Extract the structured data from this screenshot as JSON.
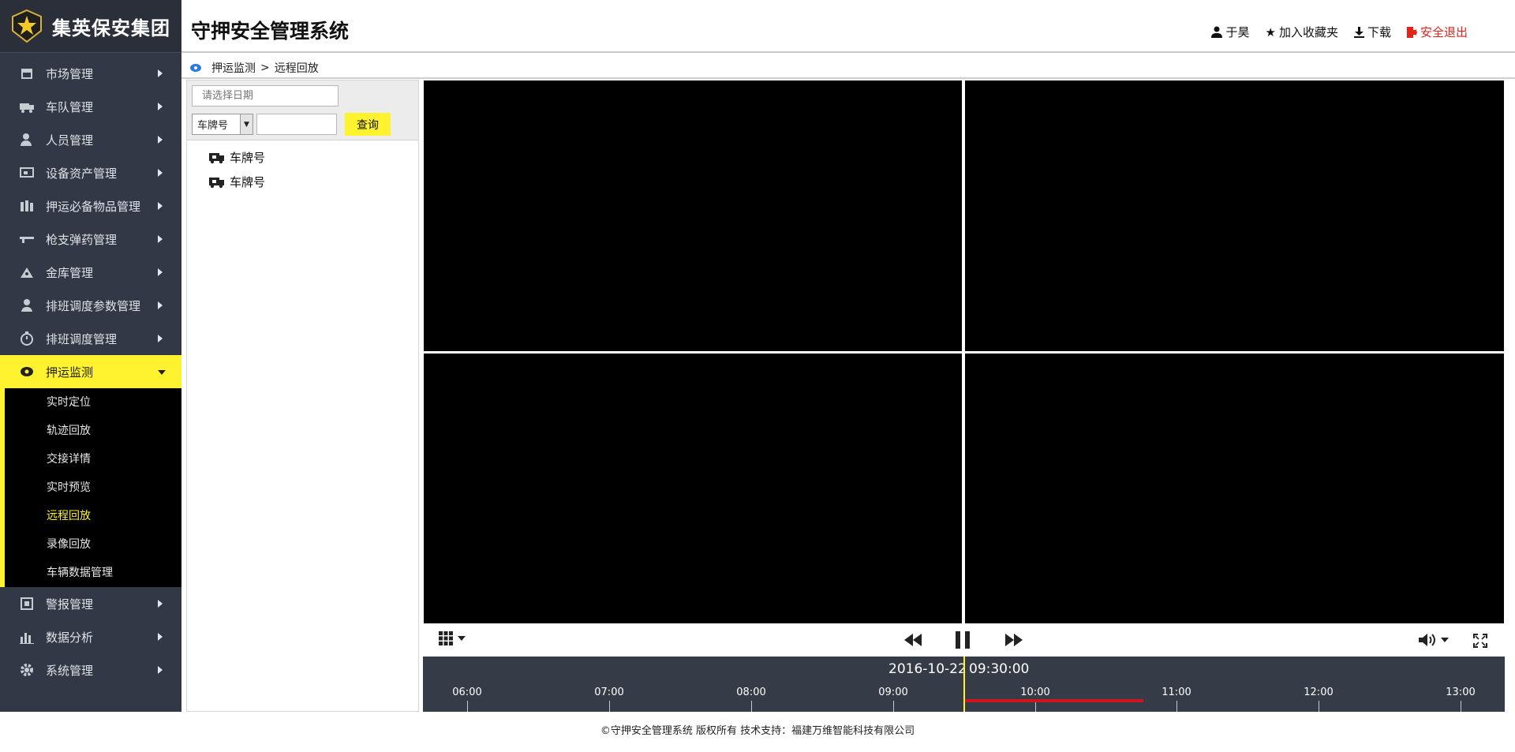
{
  "company_name": "集英保安集团",
  "system_title": "守押安全管理系统",
  "user": {
    "name": "于昊"
  },
  "header_links": {
    "favorite": "加入收藏夹",
    "download": "下载",
    "logout": "安全退出"
  },
  "breadcrumb": {
    "parent": "押运监测",
    "separator": ">",
    "current": "远程回放"
  },
  "menu": {
    "items": [
      {
        "label": "市场管理",
        "icon": "store-icon"
      },
      {
        "label": "车队管理",
        "icon": "truck-icon"
      },
      {
        "label": "人员管理",
        "icon": "person-icon"
      },
      {
        "label": "设备资产管理",
        "icon": "device-icon"
      },
      {
        "label": "押运必备物品管理",
        "icon": "supplies-icon"
      },
      {
        "label": "枪支弹药管理",
        "icon": "gun-icon"
      },
      {
        "label": "金库管理",
        "icon": "vault-icon"
      },
      {
        "label": "排班调度参数管理",
        "icon": "settings-person-icon"
      },
      {
        "label": "排班调度管理",
        "icon": "stopwatch-icon"
      },
      {
        "label": "押运监测",
        "icon": "monitor-icon",
        "active": true
      }
    ],
    "submenu": [
      "实时定位",
      "轨迹回放",
      "交接详情",
      "实时预览",
      "远程回放",
      "录像回放",
      "车辆数据管理"
    ],
    "submenu_current": "远程回放",
    "bottom_items": [
      {
        "label": "警报管理",
        "icon": "alarm-icon"
      },
      {
        "label": "数据分析",
        "icon": "bar-chart-icon"
      },
      {
        "label": "系统管理",
        "icon": "gear-icon"
      }
    ]
  },
  "search": {
    "date_placeholder": "请选择日期",
    "select_value": "车牌号",
    "query_button": "查询"
  },
  "tree": [
    "车牌号",
    "车牌号"
  ],
  "timeline": {
    "date": "2016-10-22",
    "time": "09:30:00",
    "ticks": [
      "06:00",
      "07:00",
      "08:00",
      "09:00",
      "10:00",
      "11:00",
      "12:00",
      "13:00"
    ]
  },
  "footer": "©守押安全管理系统  版权所有   技术支持：福建万维智能科技有限公司",
  "colors": {
    "accent": "#fff22e",
    "sidebar": "#323845",
    "timeline": "#353b47",
    "record": "#d1141e",
    "logout": "#e2231a"
  }
}
